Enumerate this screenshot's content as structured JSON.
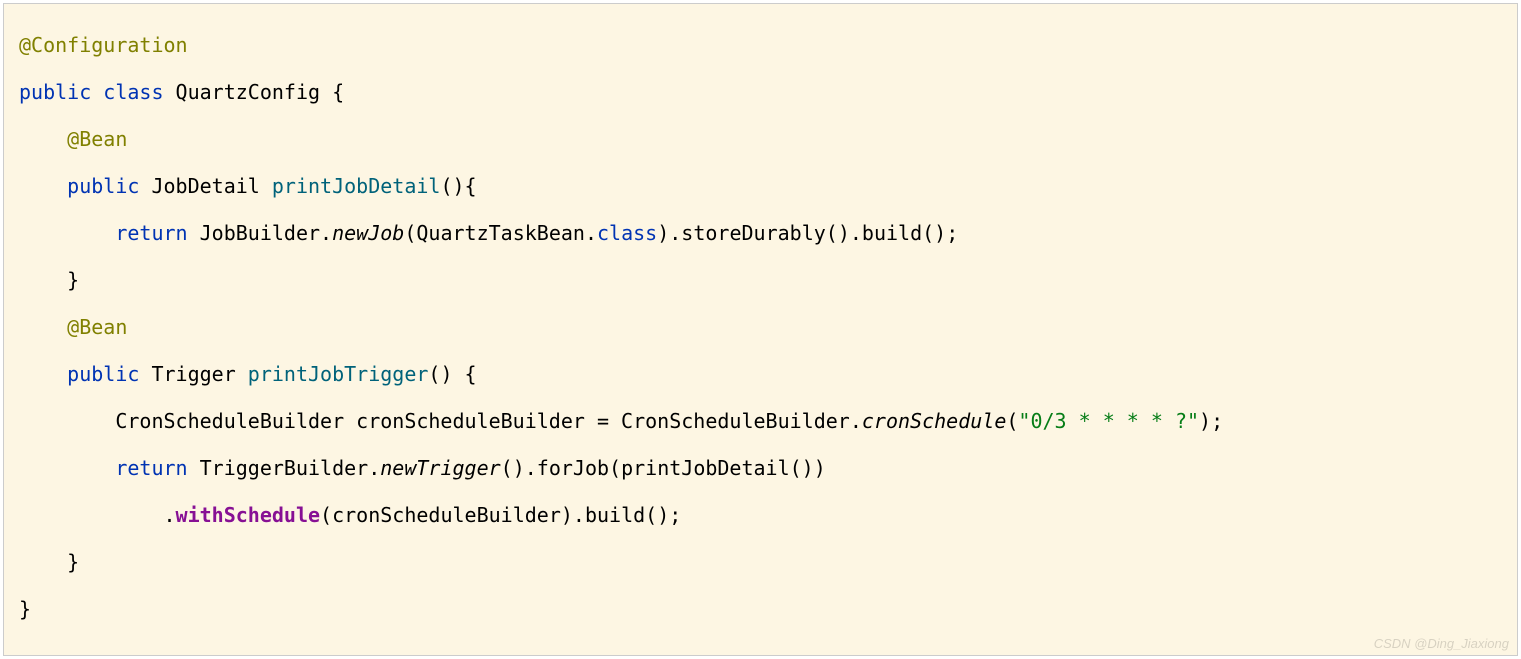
{
  "line1": {
    "a": "@Configuration"
  },
  "line2": {
    "a": "public",
    "b": " ",
    "c": "class",
    "d": " QuartzConfig {"
  },
  "line3": {
    "a": "    ",
    "b": "@Bean"
  },
  "line4": {
    "a": "    ",
    "b": "public",
    "c": " JobDetail ",
    "d": "printJobDetail",
    "e": "(){"
  },
  "line5": {
    "a": "        ",
    "b": "return",
    "c": " JobBuilder.",
    "d": "newJob",
    "e": "(QuartzTaskBean.",
    "f": "class",
    "g": ").storeDurably().build();"
  },
  "line6": {
    "a": "    }"
  },
  "line7": {
    "a": "    ",
    "b": "@Bean"
  },
  "line8": {
    "a": "    ",
    "b": "public",
    "c": " Trigger ",
    "d": "printJobTrigger",
    "e": "() {"
  },
  "line9": {
    "a": "        CronScheduleBuilder cronScheduleBuilder = CronScheduleBuilder.",
    "b": "cronSchedule",
    "c": "(",
    "d": "\"0/3 * * * * ?\"",
    "e": ");"
  },
  "line10": {
    "a": "        ",
    "b": "return",
    "c": " TriggerBuilder.",
    "d": "newTrigger",
    "e": "().forJob(printJobDetail())"
  },
  "line11": {
    "a": "            .",
    "b": "withSchedule",
    "c": "(cronScheduleBuilder).build();"
  },
  "line12": {
    "a": "    }"
  },
  "line13": {
    "a": "}"
  },
  "watermark": "CSDN @Ding_Jiaxiong"
}
